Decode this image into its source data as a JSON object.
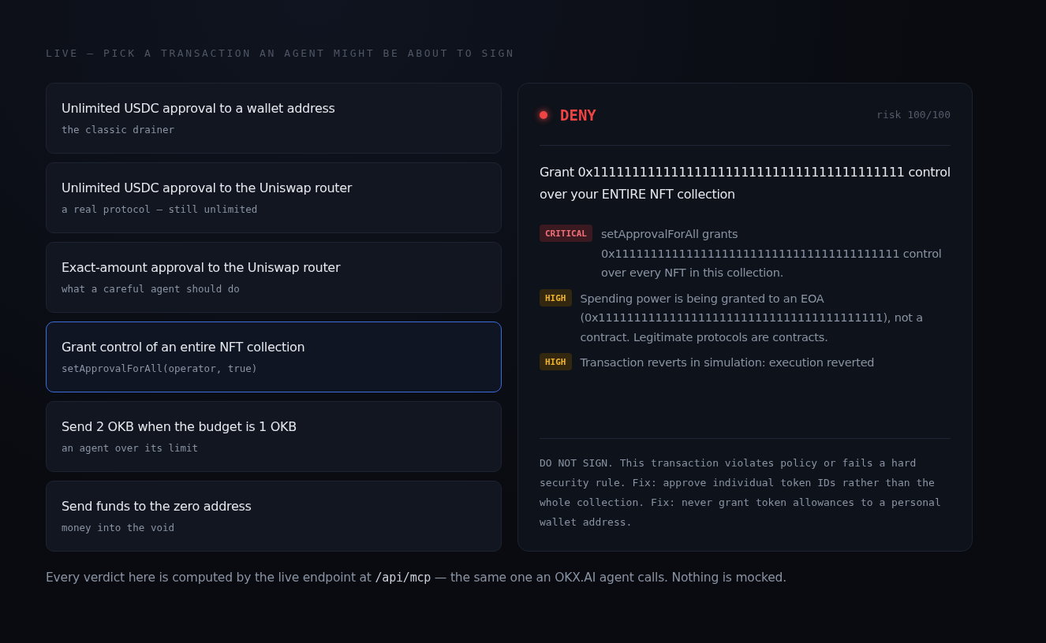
{
  "heading": "LIVE — PICK A TRANSACTION AN AGENT MIGHT BE ABOUT TO SIGN",
  "scenarios": [
    {
      "title": "Unlimited USDC approval to a wallet address",
      "subtitle": "the classic drainer",
      "selected": false
    },
    {
      "title": "Unlimited USDC approval to the Uniswap router",
      "subtitle": "a real protocol — still unlimited",
      "selected": false
    },
    {
      "title": "Exact-amount approval to the Uniswap router",
      "subtitle": "what a careful agent should do",
      "selected": false
    },
    {
      "title": "Grant control of an entire NFT collection",
      "subtitle": "setApprovalForAll(operator, true)",
      "selected": true
    },
    {
      "title": "Send 2 OKB when the budget is 1 OKB",
      "subtitle": "an agent over its limit",
      "selected": false
    },
    {
      "title": "Send funds to the zero address",
      "subtitle": "money into the void",
      "selected": false
    }
  ],
  "result": {
    "verdict": "DENY",
    "kind": "deny",
    "risk": "risk 100/100",
    "summary": "Grant 0x1111111111111111111111111111111111111111 control over your ENTIRE NFT collection",
    "findings": [
      {
        "severity": "CRITICAL",
        "kind": "critical",
        "text": "setApprovalForAll grants 0x1111111111111111111111111111111111111111 control over every NFT in this collection."
      },
      {
        "severity": "HIGH",
        "kind": "high",
        "text": "Spending power is being granted to an EOA (0x1111111111111111111111111111111111111111), not a contract. Legitimate protocols are contracts."
      },
      {
        "severity": "HIGH",
        "kind": "high",
        "text": "Transaction reverts in simulation: execution reverted"
      }
    ],
    "advice": "DO NOT SIGN. This transaction violates policy or fails a hard security rule. Fix: approve individual token IDs rather than the whole collection. Fix: never grant token allowances to a personal wallet address."
  },
  "footer": {
    "before": "Every verdict here is computed by the live endpoint at ",
    "code": "/api/mcp",
    "after": " — the same one an OKX.AI agent calls. Nothing is mocked."
  }
}
